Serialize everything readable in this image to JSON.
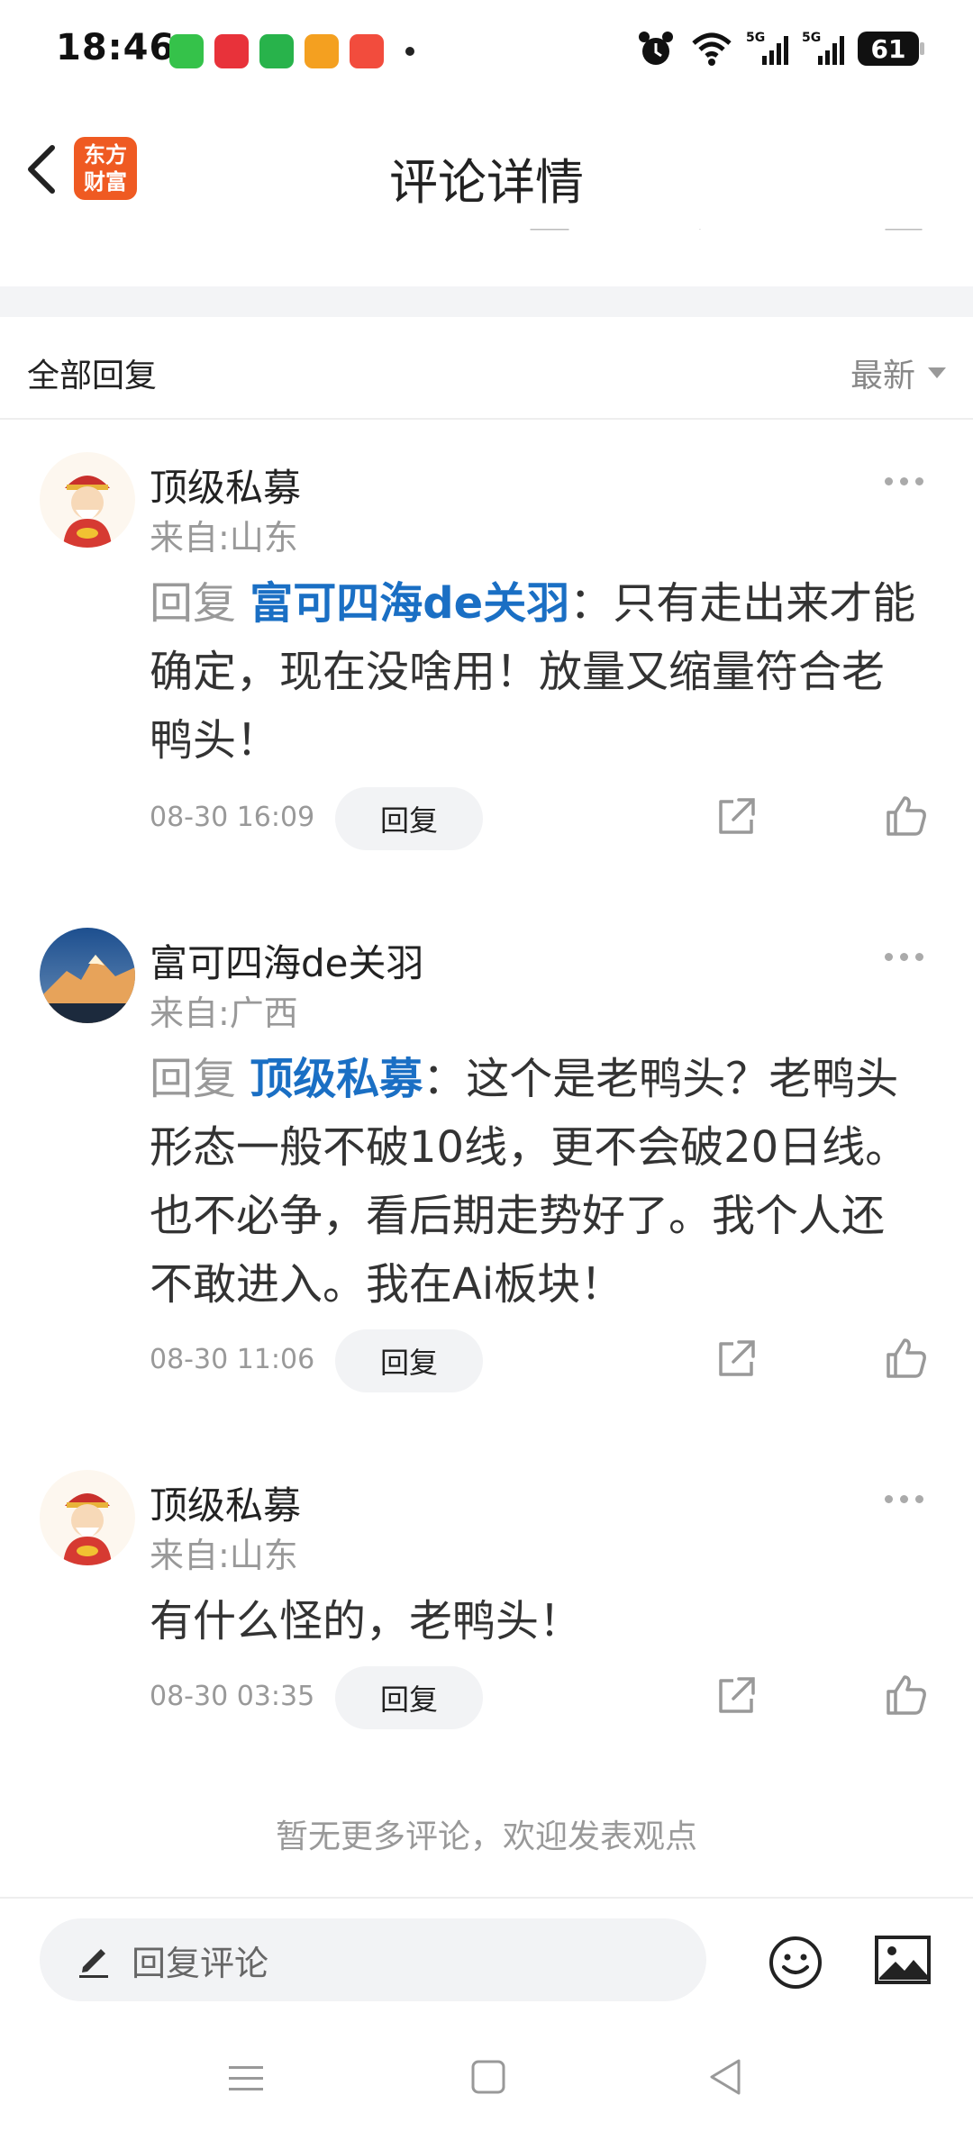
{
  "status_bar": {
    "time": "18:46",
    "battery": "61"
  },
  "header": {
    "title": "评论详情",
    "logo_line1": "东方",
    "logo_line2": "财富"
  },
  "replies_section": {
    "title": "全部回复",
    "sort_label": "最新"
  },
  "comments": [
    {
      "name": "顶级私募",
      "location": "来自:山东",
      "reply_prefix": "回复",
      "mention": "富可四海de关羽",
      "text": "：只有走出来才能确定，现在没啥用！放量又缩量符合老鸭头！",
      "time": "08-30 16:09",
      "reply_label": "回复"
    },
    {
      "name": "富可四海de关羽",
      "location": "来自:广西",
      "reply_prefix": "回复",
      "mention": "顶级私募",
      "text": "：这个是老鸭头？老鸭头形态一般不破10线，更不会破20日线。也不必争，看后期走势好了。我个人还不敢进入。我在Ai板块！",
      "time": "08-30 11:06",
      "reply_label": "回复"
    },
    {
      "name": "顶级私募",
      "location": "来自:山东",
      "text": "有什么怪的，老鸭头！",
      "time": "08-30 03:35",
      "reply_label": "回复"
    }
  ],
  "footer_note": "暂无更多评论，欢迎发表观点",
  "bottom_bar": {
    "input_placeholder": "回复评论"
  },
  "colors": {
    "accent_blue": "#1a6fc4",
    "brand_orange": "#ef5a22"
  }
}
